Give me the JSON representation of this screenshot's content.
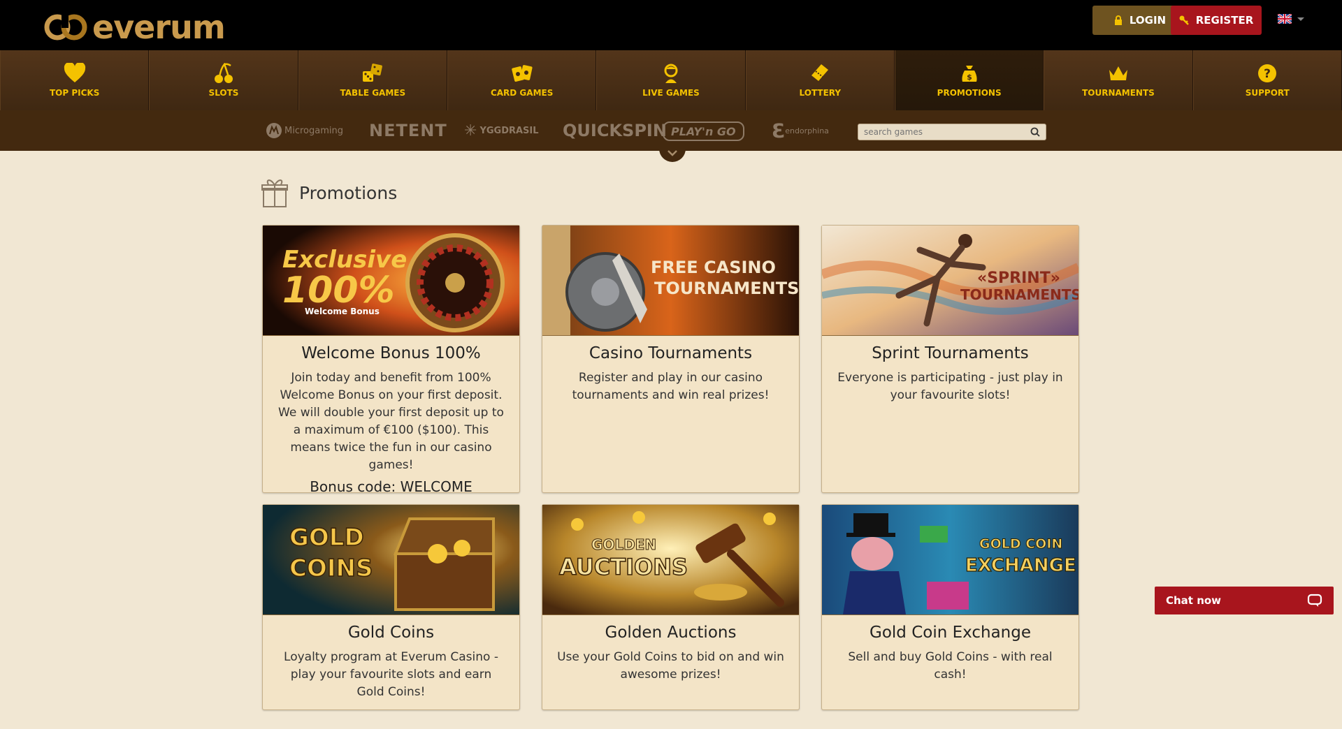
{
  "header": {
    "logo_text": "everum",
    "login_label": "LOGIN",
    "register_label": "REGISTER",
    "language_icon": "uk-flag-icon"
  },
  "nav": {
    "items": [
      {
        "label": "TOP PICKS",
        "icon": "heart-icon"
      },
      {
        "label": "SLOTS",
        "icon": "cherry-icon"
      },
      {
        "label": "TABLE GAMES",
        "icon": "dice-icon"
      },
      {
        "label": "CARD GAMES",
        "icon": "cards-icon"
      },
      {
        "label": "LIVE GAMES",
        "icon": "dealer-icon"
      },
      {
        "label": "LOTTERY",
        "icon": "ticket-icon"
      },
      {
        "label": "PROMOTIONS",
        "icon": "money-bag-icon"
      },
      {
        "label": "TOURNAMENTS",
        "icon": "crown-icon"
      },
      {
        "label": "SUPPORT",
        "icon": "question-icon"
      }
    ],
    "active": "PROMOTIONS"
  },
  "providers": [
    "Microgaming",
    "NETENT",
    "YGGDRASIL",
    "QUICKSPIN",
    "PLAY'n GO",
    "endorphina"
  ],
  "search": {
    "placeholder": "search games"
  },
  "page": {
    "title": "Promotions"
  },
  "promotions": [
    {
      "title": "Welcome Bonus 100%",
      "banner": "Exclusive 100% Welcome Bonus",
      "text": "Join today and benefit from 100% Welcome Bonus on your first deposit. We will double your first deposit up to a maximum of €100 ($100). This means twice the fun in our casino games!",
      "code": "Bonus code: WELCOME"
    },
    {
      "title": "Casino Tournaments",
      "banner": "FREE CASINO TOURNAMENTS",
      "text": "Register and play in our casino tournaments and win real prizes!"
    },
    {
      "title": "Sprint Tournaments",
      "banner": "«SPRINT» TOURNAMENTS",
      "text": "Everyone is participating - just play in your favourite slots!"
    },
    {
      "title": "Gold Coins",
      "banner": "GOLD COINS",
      "text": "Loyalty program at Everum Casino - play your favourite slots and earn Gold Coins!"
    },
    {
      "title": "Golden Auctions",
      "banner": "GOLDEN AUCTIONS",
      "text": "Use your Gold Coins to bid on and win awesome prizes!"
    },
    {
      "title": "Gold Coin Exchange",
      "banner": "GOLD COIN EXCHANGE",
      "text": "Sell and buy Gold Coins - with real cash!"
    }
  ],
  "chat": {
    "label": "Chat now"
  },
  "colors": {
    "accent": "#f4c200",
    "register": "#a8151d",
    "login": "#6e5320",
    "nav_bg": "#4a2f14"
  }
}
